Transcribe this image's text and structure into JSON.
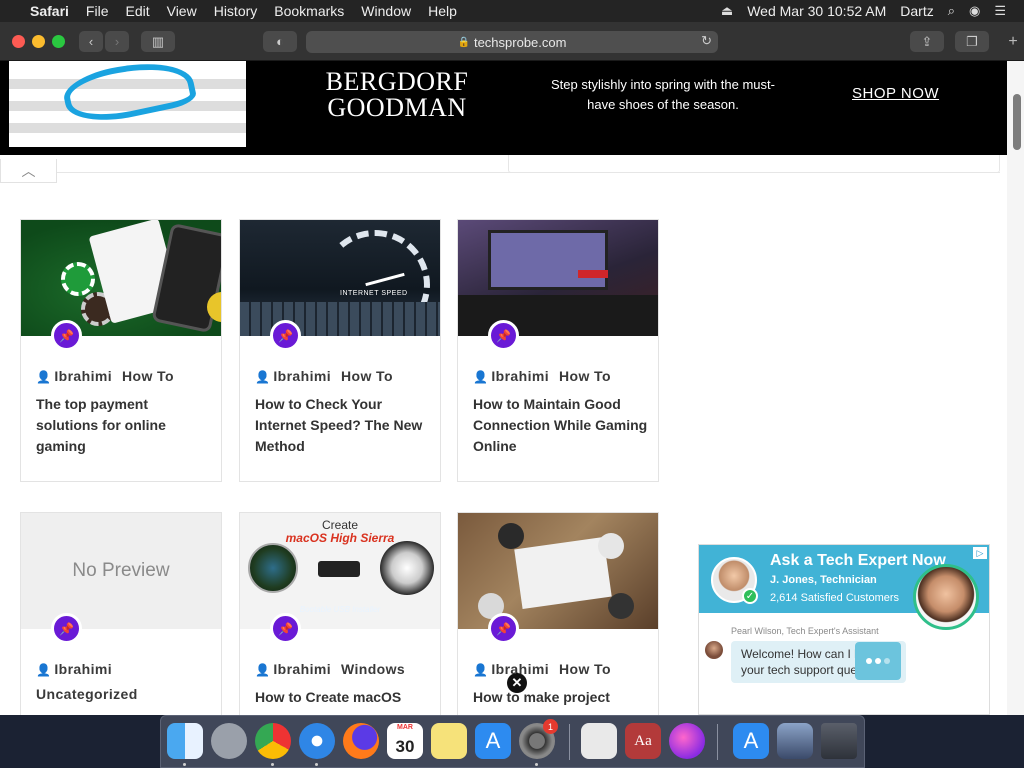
{
  "menubar": {
    "app": "Safari",
    "items": [
      "File",
      "Edit",
      "View",
      "History",
      "Bookmarks",
      "Window",
      "Help"
    ],
    "datetime": "Wed Mar 30  10:52 AM",
    "user": "Dartz"
  },
  "browser": {
    "url": "techsprobe.com"
  },
  "ad": {
    "brand_line1": "BERGDORF",
    "brand_line2": "GOODMAN",
    "tagline": "Step stylishly into spring with the must-have shoes of the season.",
    "cta": "SHOP NOW"
  },
  "posts": [
    {
      "author": "Ibrahimi",
      "category": "How To",
      "title": "The top payment solutions for online gaming",
      "thumb": "casino-chips"
    },
    {
      "author": "Ibrahimi",
      "category": "How To",
      "title": "How to Check Your Internet Speed? The New Method",
      "thumb": "speedometer",
      "thumb_text": "INTERNET SPEED"
    },
    {
      "author": "Ibrahimi",
      "category": "How To",
      "title": "How to Maintain Good Connection While Gaming Online",
      "thumb": "gaming-setup"
    },
    {
      "author": "Ibrahimi",
      "category": "Uncategorized",
      "title": "",
      "thumb": "no-preview",
      "thumb_text": "No Preview"
    },
    {
      "author": "Ibrahimi",
      "category": "Windows",
      "title": "How to Create macOS",
      "thumb": "usb-installer",
      "thumb_text_1": "Create",
      "thumb_text_2": "macOS High Sierra",
      "thumb_text_3": "Bootable USB Installer"
    },
    {
      "author": "Ibrahimi",
      "category": "How To",
      "title": "How to make project",
      "thumb": "meeting-table"
    }
  ],
  "chat": {
    "title": "Ask a Tech Expert Now",
    "expert": "J. Jones, Technician",
    "customers": "2,614 Satisfied Customers",
    "assistant_label": "Pearl Wilson, Tech Expert's Assistant",
    "message": "Welcome! How can I he... your tech support question?"
  },
  "dock": {
    "calendar_month": "MAR",
    "calendar_day": "30",
    "badge": "1",
    "dictionary": "Aa"
  },
  "colors": {
    "pin_purple": "#6a1ad6",
    "chat_blue": "#41b3d6"
  }
}
